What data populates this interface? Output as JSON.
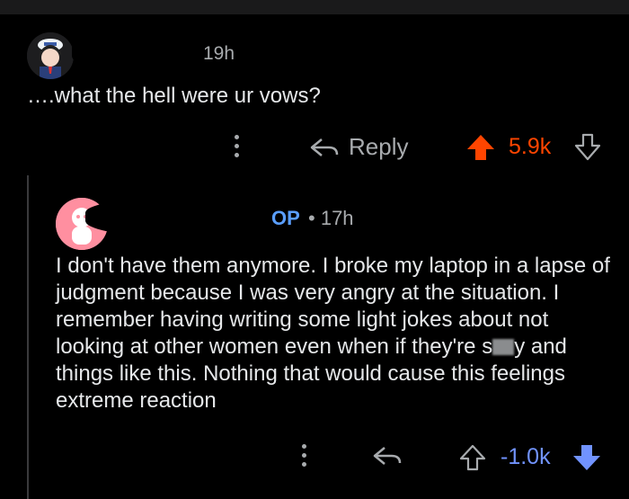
{
  "comment1": {
    "time": "19h",
    "text": "….what the hell were ur vows?",
    "reply_label": "Reply",
    "score": "5.9k",
    "upvote_color": "#ff4500"
  },
  "comment2": {
    "op_label": "OP",
    "separator": "•",
    "time": "17h",
    "text_before": "I don't have them anymore. I broke my laptop in a lapse of judgment because I was very angry at the situation. I remember having writing some light jokes about not looking at other women even when if they're s",
    "text_after": "y and things like this. Nothing that would cause this feelings extreme reaction",
    "score": "-1.0k",
    "downvote_color": "#7193ff"
  }
}
